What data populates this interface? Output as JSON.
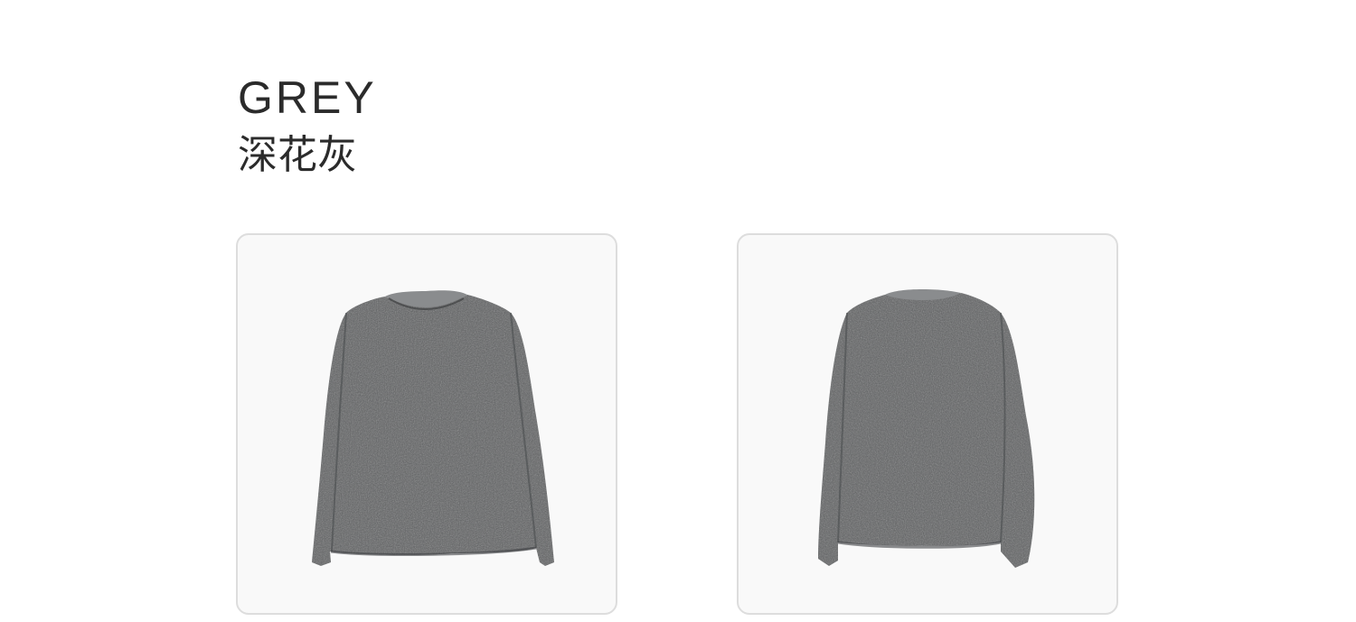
{
  "product": {
    "color_name_en": "GREY",
    "color_name_cn": "深花灰"
  },
  "images": [
    {
      "view": "front",
      "icon": "sweater-front-image"
    },
    {
      "view": "back",
      "icon": "sweater-back-image"
    }
  ],
  "colors": {
    "page_background": "#ffffff",
    "card_background": "#f9f9f9",
    "card_border": "#dddddd",
    "text": "#2b2b2b",
    "sweater": "#5e6062",
    "sweater_shadow": "#4a4c4e",
    "sweater_rib": "#8a8c8e"
  }
}
